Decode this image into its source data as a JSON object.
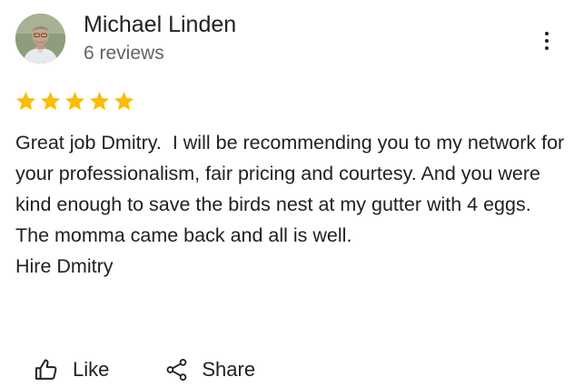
{
  "review": {
    "author_name": "Michael Linden",
    "review_count": "6 reviews",
    "rating": 5,
    "text": "Great job Dmitry.  I will be recommending you to my network for your professionalism, fair pricing and courtesy. And you were kind enough to save the birds nest at my gutter with 4 eggs. The momma came back and all is well.\nHire Dmitry"
  },
  "actions": {
    "like_label": "Like",
    "share_label": "Share"
  },
  "icons": {
    "more": "more-vertical-icon",
    "star": "star-icon",
    "like": "thumb-up-icon",
    "share": "share-icon"
  },
  "colors": {
    "star": "#fbbc04",
    "text_primary": "#202124",
    "text_secondary": "#5f6368"
  }
}
